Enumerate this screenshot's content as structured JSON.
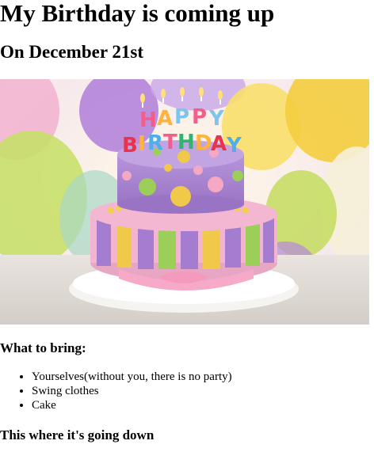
{
  "page": {
    "title": "My Birthday is coming up",
    "subtitle": "On December 21st"
  },
  "image": {
    "alt": "Birthday cake",
    "cake_topper": "HAPPY BIRTHDAY",
    "colors": {
      "purple": "#a882cf",
      "yellow": "#f0c84a",
      "green": "#9ccf5a",
      "pink": "#f4a8c4",
      "plate": "#f4f2ef"
    }
  },
  "bring": {
    "heading": "What to bring:",
    "items": [
      "Yourselves(without you, there is no party)",
      "Swing clothes",
      "Cake"
    ]
  },
  "location": {
    "heading": "This where it's going down"
  }
}
